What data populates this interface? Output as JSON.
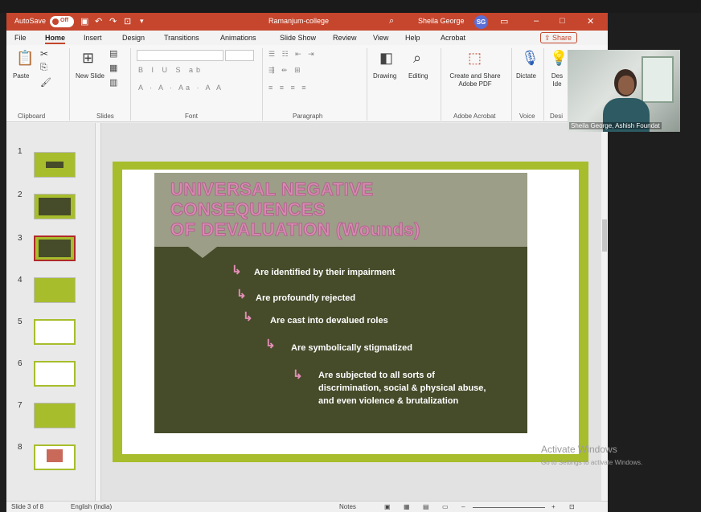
{
  "titlebar": {
    "autosave": "AutoSave",
    "autosave_state": "Off",
    "filename": "Ramanjum-college",
    "user": "Sheila George",
    "user_initials": "SG"
  },
  "menu": [
    "File",
    "Home",
    "Insert",
    "Design",
    "Transitions",
    "Animations",
    "Slide Show",
    "Review",
    "View",
    "Help",
    "Acrobat"
  ],
  "share": "Share",
  "ribbon": {
    "paste": "Paste",
    "new_slide": "New Slide",
    "drawing": "Drawing",
    "editing": "Editing",
    "create_share": "Create and Share Adobe PDF",
    "dictate": "Dictate",
    "design_ideas": "Des Ide",
    "groups": [
      "Clipboard",
      "Slides",
      "Font",
      "Paragraph",
      "Adobe Acrobat",
      "Voice",
      "Desi"
    ]
  },
  "thumbnails": [
    "1",
    "2",
    "3",
    "4",
    "5",
    "6",
    "7",
    "8"
  ],
  "slide": {
    "title_lines": [
      "UNIVERSAL NEGATIVE",
      "CONSEQUENCES",
      "OF DEVALUATION (Wounds)"
    ],
    "bullets": [
      "Are identified by their impairment",
      "Are profoundly rejected",
      "Are cast into devalued roles",
      "Are symbolically stigmatized",
      "Are subjected to all sorts of",
      "discrimination, social & physical abuse,",
      "and even violence & brutalization"
    ]
  },
  "statusbar": {
    "slide_info": "Slide 3 of 8",
    "language": "English (India)",
    "notes": "Notes"
  },
  "video": {
    "name": "Sheila George, Ashish Foundat"
  },
  "watermark": {
    "line1": "Activate Windows",
    "line2": "Go to Settings to activate Windows."
  },
  "colors": {
    "titlebar": "#c5462d",
    "slide_border": "#a8bd2c",
    "slide_body": "#464b2a",
    "title_pink": "#d98cb2"
  }
}
